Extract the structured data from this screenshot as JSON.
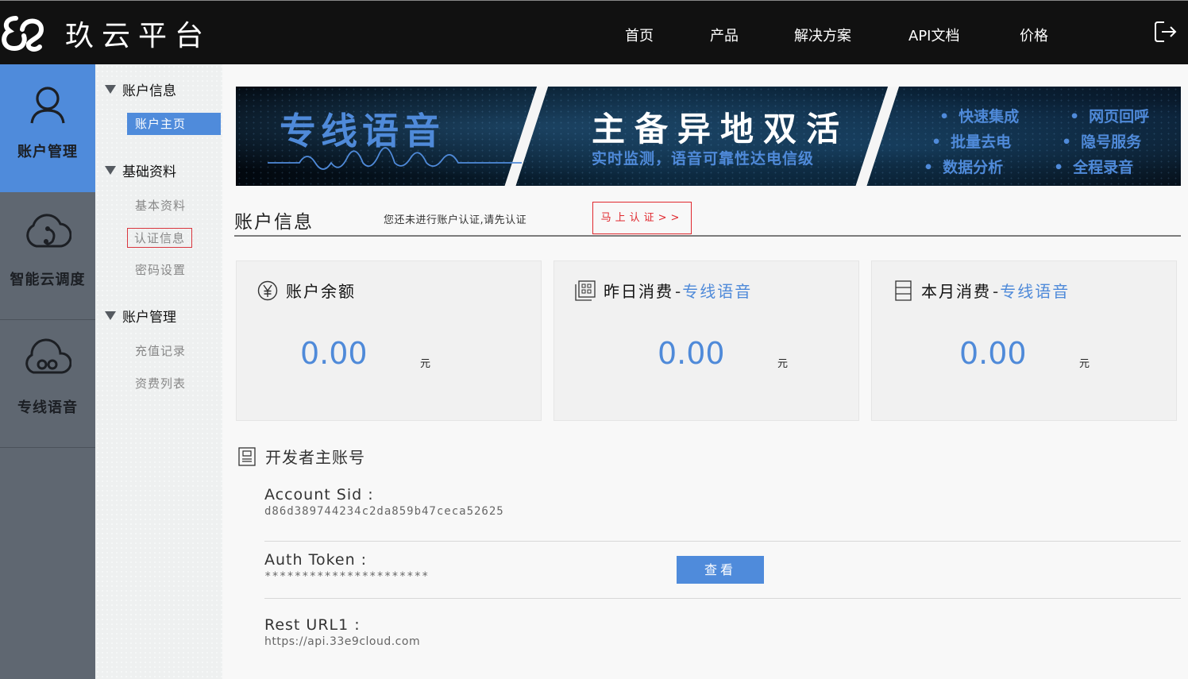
{
  "header": {
    "logo_text": "玖云平台",
    "nav": [
      "首页",
      "产品",
      "解决方案",
      "API文档",
      "价格"
    ],
    "logout_icon": "logout-icon"
  },
  "rail": {
    "items": [
      {
        "label": "账户管理",
        "icon": "user-icon",
        "active": true
      },
      {
        "label": "智能云调度",
        "icon": "cloud-nodes-icon",
        "active": false
      },
      {
        "label": "专线语音",
        "icon": "cloud-voice-icon",
        "active": false
      }
    ]
  },
  "subnav": {
    "groups": [
      {
        "label": "账户信息",
        "items": [
          {
            "label": "账户主页",
            "state": "active"
          }
        ]
      },
      {
        "label": "基础资料",
        "items": [
          {
            "label": "基本资料",
            "state": "normal"
          },
          {
            "label": "认证信息",
            "state": "outlined"
          },
          {
            "label": "密码设置",
            "state": "normal"
          }
        ]
      },
      {
        "label": "账户管理",
        "items": [
          {
            "label": "充值记录",
            "state": "normal"
          },
          {
            "label": "资费列表",
            "state": "normal"
          }
        ]
      }
    ]
  },
  "banner": {
    "title1": "专线语音",
    "title2": "主备异地双活",
    "subtitle2": "实时监测，语音可靠性达电信级",
    "features": [
      "快速集成",
      "网页回呼",
      "批量去电",
      "隐号服务",
      "数据分析",
      "全程录音"
    ]
  },
  "account_info": {
    "title": "账户信息",
    "notice": "您还未进行账户认证,请先认证",
    "verify_button": "马上认证>>"
  },
  "cards": [
    {
      "title": "账户余额",
      "product": "",
      "value": "0.00",
      "unit": "元",
      "icon": "yuan-icon"
    },
    {
      "title": "昨日消费",
      "product": "专线语音",
      "value": "0.00",
      "unit": "元",
      "icon": "grid-icon"
    },
    {
      "title": "本月消费",
      "product": "专线语音",
      "value": "0.00",
      "unit": "元",
      "icon": "list-icon"
    }
  ],
  "card_separator": "-",
  "developer": {
    "title": "开发者主账号",
    "fields": [
      {
        "label": "Account Sid :",
        "value": "d86d389744234c2da859b47ceca52625"
      },
      {
        "label": "Auth Token :",
        "value": "**********************"
      },
      {
        "label": "Rest URL1 :",
        "value": "https://api.33e9cloud.com"
      }
    ],
    "view_button": "查看"
  },
  "colors": {
    "accent": "#4f8bdb",
    "alert": "#e0282e",
    "topbar": "#111111",
    "rail": "#5f6771"
  }
}
